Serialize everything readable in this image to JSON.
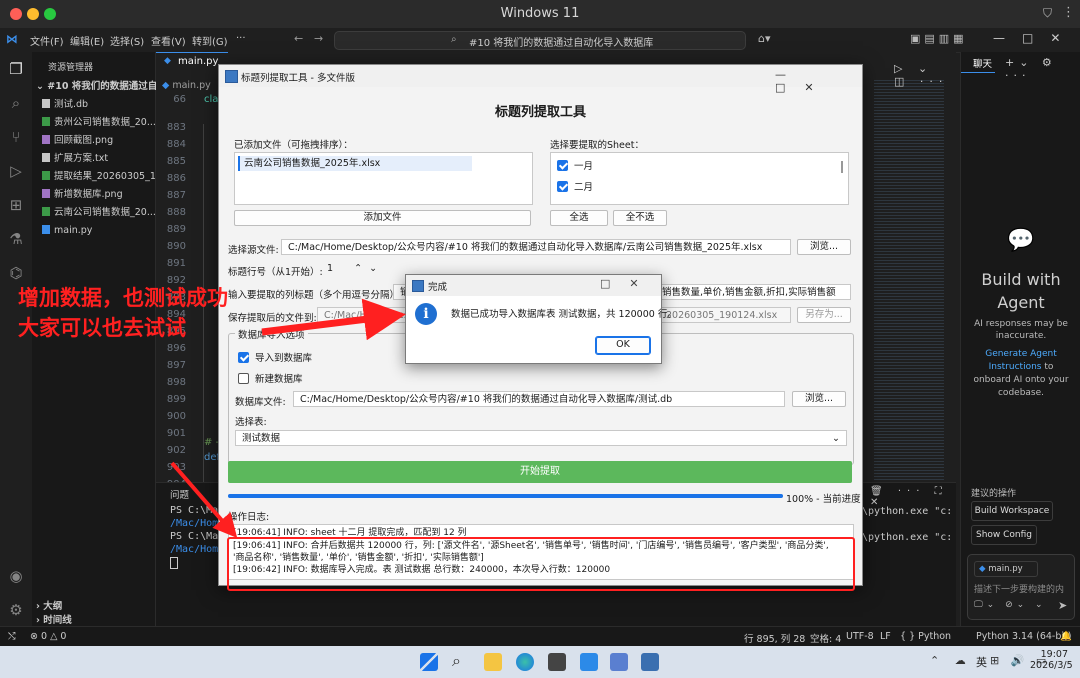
{
  "mac": {
    "title": "Windows 11"
  },
  "vscode": {
    "menu": [
      "文件(F)",
      "编辑(E)",
      "选择(S)",
      "查看(V)",
      "转到(G)",
      "···"
    ],
    "search_text": "#10 将我们的数据通过自动化导入数据库",
    "explorer_title": "资源管理器",
    "folder": "#10 将我们的数据通过自动化...",
    "files": [
      {
        "name": "测试.db",
        "color": "#c6c6c6"
      },
      {
        "name": "贵州公司销售数据_20...",
        "color": "#3c9a48"
      },
      {
        "name": "回顾截图.png",
        "color": "#a074c4"
      },
      {
        "name": "扩展方案.txt",
        "color": "#c6c6c6"
      },
      {
        "name": "提取结果_20260305_1...",
        "color": "#3c9a48"
      },
      {
        "name": "新增数据库.png",
        "color": "#a074c4"
      },
      {
        "name": "云南公司销售数据_20...",
        "color": "#3c9a48"
      },
      {
        "name": "main.py",
        "color": "#3b8eea"
      }
    ],
    "outline": "大纲",
    "timeline": "时间线",
    "tab": "main.py",
    "breadcrumb": "main.py",
    "line_numbers": [
      "66",
      "883",
      "884",
      "885",
      "886",
      "887",
      "888",
      "889",
      "890",
      "891",
      "892",
      "893",
      "894",
      "895",
      "896",
      "897",
      "898",
      "899",
      "900",
      "901",
      "902",
      "903",
      "904",
      "905",
      "906",
      "907",
      "908"
    ],
    "code_snips": {
      "l66": "cla",
      "l902": "# -",
      "l903": "def"
    },
    "terminal": {
      "tab_problems": "问题",
      "lines": [
        "PS C:\\Mac",
        "/Mac/Home",
        "PS C:\\Mac",
        "/Mac/Home"
      ],
      "right_lines": [
        "\\python.exe \"c:",
        "\\python.exe \"c:"
      ]
    },
    "chat": {
      "tab": "聊天",
      "title": "Build with Agent",
      "note": "AI responses may be inaccurate.",
      "link": "Generate Agent Instructions",
      "link_tail": "to onboard AI onto your codebase.",
      "suggest_label": "建议的操作",
      "btn1": "Build Workspace",
      "btn2": "Show Config",
      "chip": "main.py",
      "placeholder": "描述下一步要构建的内"
    },
    "status": {
      "errors": "0",
      "warnings": "0",
      "position": "行 895, 列 28",
      "spaces": "空格: 4",
      "encoding": "UTF-8",
      "eol": "LF",
      "lang": "Python",
      "interpreter": "Python 3.14 (64-bit)"
    }
  },
  "tool": {
    "window_title": "标题列提取工具 - 多文件版",
    "heading": "标题列提取工具",
    "added_files_label": "已添加文件（可拖拽排序）：",
    "added_files": [
      "云南公司销售数据_2025年.xlsx"
    ],
    "add_file_btn": "添加文件",
    "sheet_label": "选择要提取的Sheet：",
    "sheets": [
      "一月",
      "二月"
    ],
    "select_all_btn": "全选",
    "select_none_btn": "全不选",
    "source_label": "选择源文件:",
    "source_path": "C:/Mac/Home/Desktop/公众号内容/#10 将我们的数据通过自动化导入数据库/云南公司销售数据_2025年.xlsx",
    "browse_btn": "浏览...",
    "header_row_label": "标题行号（从1开始）:",
    "header_row_value": "1",
    "cols_label": "输入要提取的列标题（多个用逗号分隔）：",
    "cols_value_left": "销",
    "cols_value_right": "销售数量,单价,销售金额,折扣,实际销售额",
    "save_label": "保存提取后的文件到:",
    "save_value_left": "C:/Mac/Home/Deskt",
    "save_value_right": "20260305_190124.xlsx",
    "save_as_btn": "另存为...",
    "db_group_title": "数据库导入选项",
    "import_db_label": "导入到数据库",
    "new_db_label": "新建数据库",
    "db_file_label": "数据库文件:",
    "db_file_path": "C:/Mac/Home/Desktop/公众号内容/#10 将我们的数据通过自动化导入数据库/测试.db",
    "db_browse_btn": "浏览...",
    "table_label": "选择表:",
    "table_value": "测试数据",
    "start_btn": "开始提取",
    "progress_percent": 100,
    "progress_text": "100% - 当前进度",
    "log_label": "操作日志:",
    "log_lines": [
      "[19:06:41] INFO:    sheet 十二月 提取完成，匹配到 12 列",
      "[19:06:41] INFO: 合并后数据共 120000 行，列: ['源文件名', '源Sheet名', '销售单号', '销售时间', '门店编号', '销售员编号', '客户类型', '商品分类', '商品名称', '销售数量', '单价', '销售金额', '折扣', '实际销售额']",
      "[19:06:42] INFO: 数据库导入完成。表 测试数据 总行数：240000，本次导入行数：120000"
    ]
  },
  "dialog": {
    "title": "完成",
    "message": "数据已成功导入数据库表 测试数据，共 120000 行。",
    "ok": "OK"
  },
  "annotation": {
    "line1": "增加数据，也测试成功",
    "line2": "大家可以也去试试"
  },
  "taskbar": {
    "ime": "英",
    "time": "19:07",
    "date": "2026/3/5"
  },
  "colors": {
    "accent": "#1a73e8",
    "progress_green": "#5cb85c",
    "annotation_red": "#ff2020"
  }
}
